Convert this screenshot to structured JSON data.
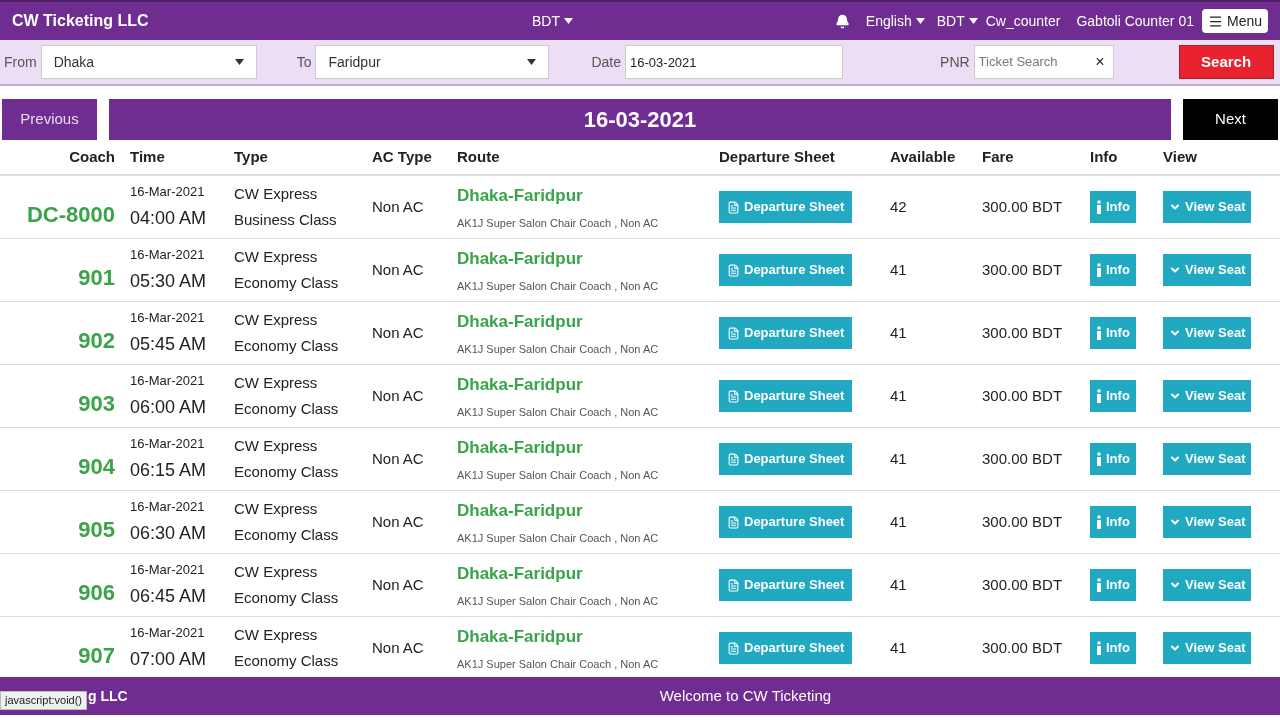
{
  "header": {
    "brand": "CW Ticketing LLC",
    "currency_center": "BDT",
    "language": "English",
    "currency": "BDT",
    "user": "Cw_counter",
    "counter": "Gabtoli Counter 01",
    "menu": "Menu"
  },
  "search": {
    "from_label": "From",
    "from": "Dhaka",
    "to_label": "To",
    "to": "Faridpur",
    "date_label": "Date",
    "date": "16-03-2021",
    "pnr_label": "PNR",
    "pnr_placeholder": "Ticket Search",
    "clear": "×",
    "button": "Search"
  },
  "nav": {
    "previous": "Previous",
    "date": "16-03-2021",
    "next": "Next"
  },
  "table": {
    "columns": [
      "Coach",
      "Time",
      "Type",
      "AC Type",
      "Route",
      "Departure Sheet",
      "Available",
      "Fare",
      "Info",
      "View"
    ],
    "rows": [
      {
        "coach": "DC-8000",
        "date": "16-Mar-2021",
        "time": "04:00 AM",
        "type": [
          "CW Express",
          "Business Class"
        ],
        "ac": "Non AC",
        "route": "Dhaka-Faridpur",
        "detail": "AK1J Super Salon Chair Coach , Non AC",
        "sheet": "Departure Sheet",
        "available": "42",
        "fare": "300.00 BDT",
        "info": "Info",
        "view": "View Seat"
      },
      {
        "coach": "901",
        "date": "16-Mar-2021",
        "time": "05:30 AM",
        "type": [
          "CW Express",
          "Economy Class"
        ],
        "ac": "Non AC",
        "route": "Dhaka-Faridpur",
        "detail": "AK1J Super Salon Chair Coach , Non AC",
        "sheet": "Departure Sheet",
        "available": "41",
        "fare": "300.00 BDT",
        "info": "Info",
        "view": "View Seat"
      },
      {
        "coach": "902",
        "date": "16-Mar-2021",
        "time": "05:45 AM",
        "type": [
          "CW Express",
          "Economy Class"
        ],
        "ac": "Non AC",
        "route": "Dhaka-Faridpur",
        "detail": "AK1J Super Salon Chair Coach , Non AC",
        "sheet": "Departure Sheet",
        "available": "41",
        "fare": "300.00 BDT",
        "info": "Info",
        "view": "View Seat"
      },
      {
        "coach": "903",
        "date": "16-Mar-2021",
        "time": "06:00 AM",
        "type": [
          "CW Express",
          "Economy Class"
        ],
        "ac": "Non AC",
        "route": "Dhaka-Faridpur",
        "detail": "AK1J Super Salon Chair Coach , Non AC",
        "sheet": "Departure Sheet",
        "available": "41",
        "fare": "300.00 BDT",
        "info": "Info",
        "view": "View Seat"
      },
      {
        "coach": "904",
        "date": "16-Mar-2021",
        "time": "06:15 AM",
        "type": [
          "CW Express",
          "Economy Class"
        ],
        "ac": "Non AC",
        "route": "Dhaka-Faridpur",
        "detail": "AK1J Super Salon Chair Coach , Non AC",
        "sheet": "Departure Sheet",
        "available": "41",
        "fare": "300.00 BDT",
        "info": "Info",
        "view": "View Seat"
      },
      {
        "coach": "905",
        "date": "16-Mar-2021",
        "time": "06:30 AM",
        "type": [
          "CW Express",
          "Economy Class"
        ],
        "ac": "Non AC",
        "route": "Dhaka-Faridpur",
        "detail": "AK1J Super Salon Chair Coach , Non AC",
        "sheet": "Departure Sheet",
        "available": "41",
        "fare": "300.00 BDT",
        "info": "Info",
        "view": "View Seat"
      },
      {
        "coach": "906",
        "date": "16-Mar-2021",
        "time": "06:45 AM",
        "type": [
          "CW Express",
          "Economy Class"
        ],
        "ac": "Non AC",
        "route": "Dhaka-Faridpur",
        "detail": "AK1J Super Salon Chair Coach , Non AC",
        "sheet": "Departure Sheet",
        "available": "41",
        "fare": "300.00 BDT",
        "info": "Info",
        "view": "View Seat"
      },
      {
        "coach": "907",
        "date": "16-Mar-2021",
        "time": "07:00 AM",
        "type": [
          "CW Express",
          "Economy Class"
        ],
        "ac": "Non AC",
        "route": "Dhaka-Faridpur",
        "detail": "AK1J Super Salon Chair Coach , Non AC",
        "sheet": "Departure Sheet",
        "available": "41",
        "fare": "300.00 BDT",
        "info": "Info",
        "view": "View Seat"
      }
    ]
  },
  "footer": {
    "status_link": "javascript:void()",
    "brand_visible": "g LLC",
    "welcome": "Welcome to CW Ticketing"
  }
}
